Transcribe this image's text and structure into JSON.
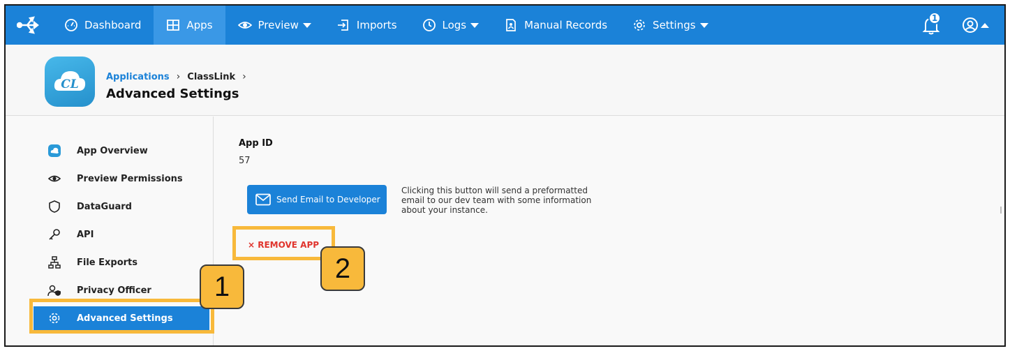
{
  "nav": {
    "items": [
      {
        "label": "Dashboard",
        "icon": "dashboard-icon"
      },
      {
        "label": "Apps",
        "icon": "apps-grid-icon",
        "active": true
      },
      {
        "label": "Preview",
        "icon": "eye-icon",
        "dropdown": true
      },
      {
        "label": "Imports",
        "icon": "import-icon"
      },
      {
        "label": "Logs",
        "icon": "clock-icon",
        "dropdown": true
      },
      {
        "label": "Manual Records",
        "icon": "record-icon"
      },
      {
        "label": "Settings",
        "icon": "gear-icon",
        "dropdown": true
      }
    ],
    "notification_count": "1",
    "accent": "#1b82d8"
  },
  "header": {
    "breadcrumb": [
      "Applications",
      "ClassLink"
    ],
    "separator": "›",
    "title": "Advanced Settings"
  },
  "sidebar": {
    "items": [
      {
        "label": "App Overview",
        "icon": "app-overview-icon"
      },
      {
        "label": "Preview Permissions",
        "icon": "eye-icon"
      },
      {
        "label": "DataGuard",
        "icon": "shield-icon"
      },
      {
        "label": "API",
        "icon": "key-icon"
      },
      {
        "label": "File Exports",
        "icon": "network-icon"
      },
      {
        "label": "Privacy Officer",
        "icon": "user-shield-icon"
      },
      {
        "label": "Advanced Settings",
        "icon": "gear-icon",
        "active": true
      }
    ]
  },
  "main": {
    "app_id_label": "App ID",
    "app_id_value": "57",
    "email_button": "Send Email to Developer",
    "email_help": "Clicking this button will send a preformatted email to our dev team with some information about your instance.",
    "remove_app": "× REMOVE APP"
  },
  "callouts": [
    "1",
    "2"
  ],
  "highlight_color": "#f8b93b"
}
